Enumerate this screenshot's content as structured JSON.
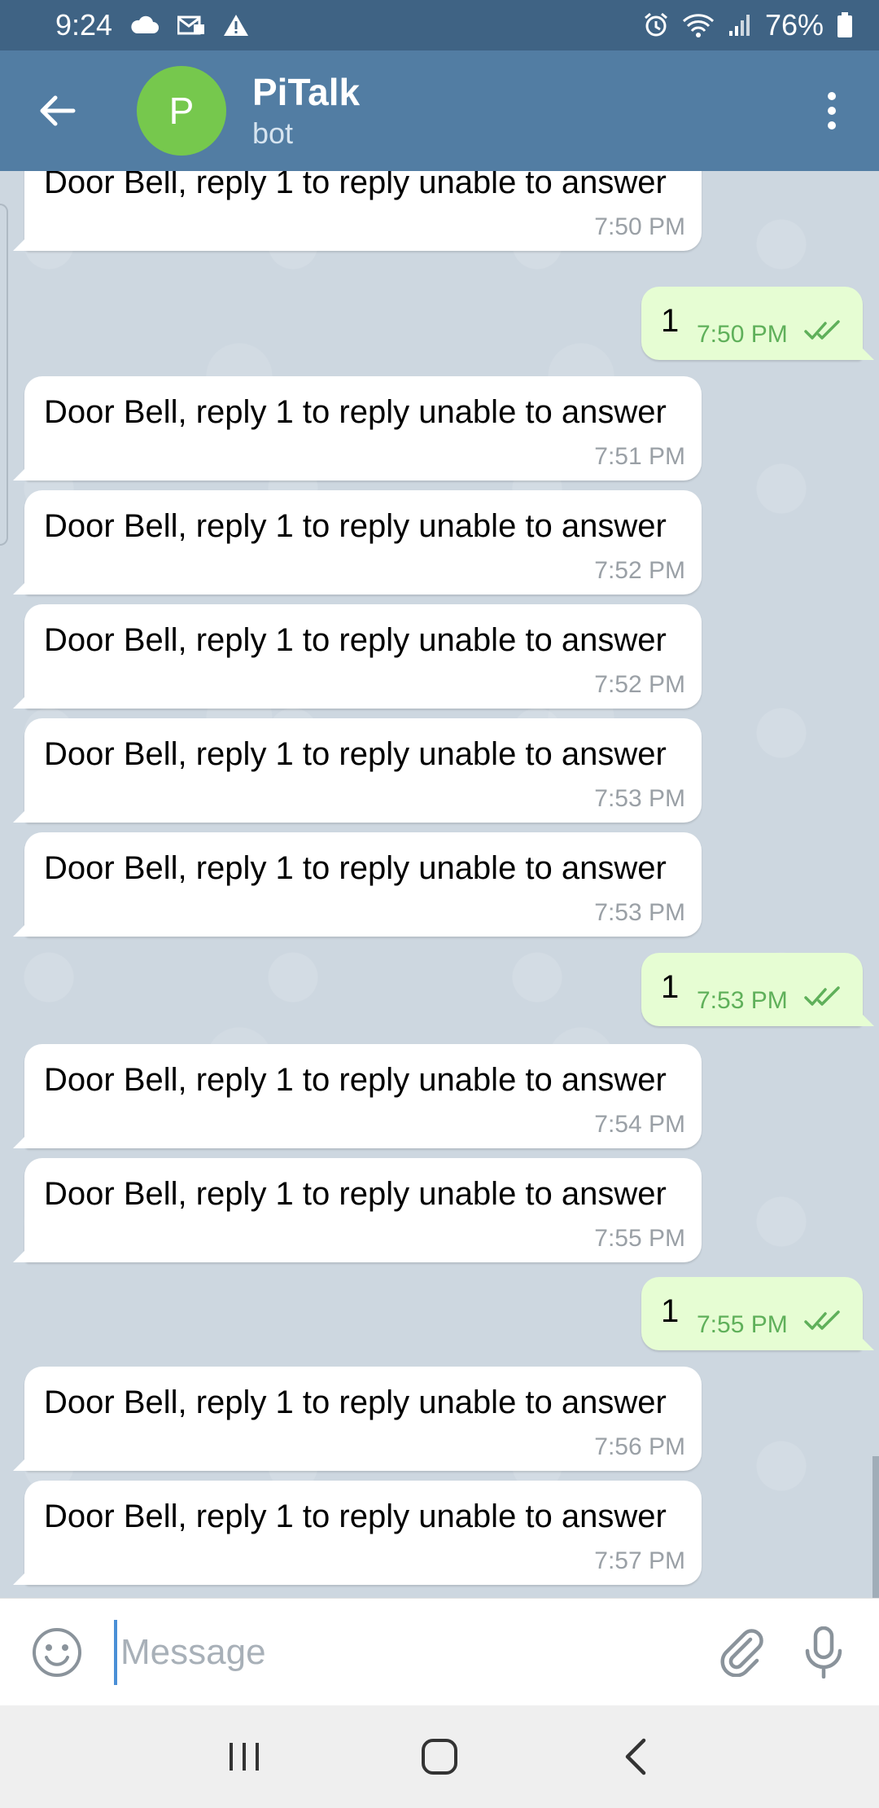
{
  "status_bar": {
    "time": "9:24",
    "battery": "76%",
    "left_icons": [
      "cloud-icon",
      "email-icon",
      "warning-icon"
    ],
    "right_icons": [
      "alarm-icon",
      "wifi-icon",
      "signal-icon",
      "battery-icon"
    ]
  },
  "header": {
    "avatar_letter": "P",
    "title": "PiTalk",
    "subtitle": "bot",
    "colors": {
      "header_bg": "#527da3",
      "avatar_bg": "#76c84d"
    }
  },
  "messages": [
    {
      "dir": "in",
      "text": "Door Bell, reply 1 to reply unable to answer",
      "time": "7:50 PM"
    },
    {
      "dir": "out",
      "text": "1",
      "time": "7:50 PM",
      "read": true
    },
    {
      "dir": "in",
      "text": "Door Bell, reply 1 to reply unable to answer",
      "time": "7:51 PM"
    },
    {
      "dir": "in",
      "text": "Door Bell, reply 1 to reply unable to answer",
      "time": "7:52 PM"
    },
    {
      "dir": "in",
      "text": "Door Bell, reply 1 to reply unable to answer",
      "time": "7:52 PM"
    },
    {
      "dir": "in",
      "text": "Door Bell, reply 1 to reply unable to answer",
      "time": "7:53 PM"
    },
    {
      "dir": "in",
      "text": "Door Bell, reply 1 to reply unable to answer",
      "time": "7:53 PM"
    },
    {
      "dir": "out",
      "text": "1",
      "time": "7:53 PM",
      "read": true
    },
    {
      "dir": "in",
      "text": "Door Bell, reply 1 to reply unable to answer",
      "time": "7:54 PM"
    },
    {
      "dir": "in",
      "text": "Door Bell, reply 1 to reply unable to answer",
      "time": "7:55 PM"
    },
    {
      "dir": "out",
      "text": "1",
      "time": "7:55 PM",
      "read": true
    },
    {
      "dir": "in",
      "text": "Door Bell, reply 1 to reply unable to answer",
      "time": "7:56 PM"
    },
    {
      "dir": "in",
      "text": "Door Bell, reply 1 to reply unable to answer",
      "time": "7:57 PM"
    }
  ],
  "input": {
    "placeholder": "Message",
    "value": ""
  },
  "nav": [
    "recent-apps-icon",
    "home-icon",
    "back-icon"
  ]
}
